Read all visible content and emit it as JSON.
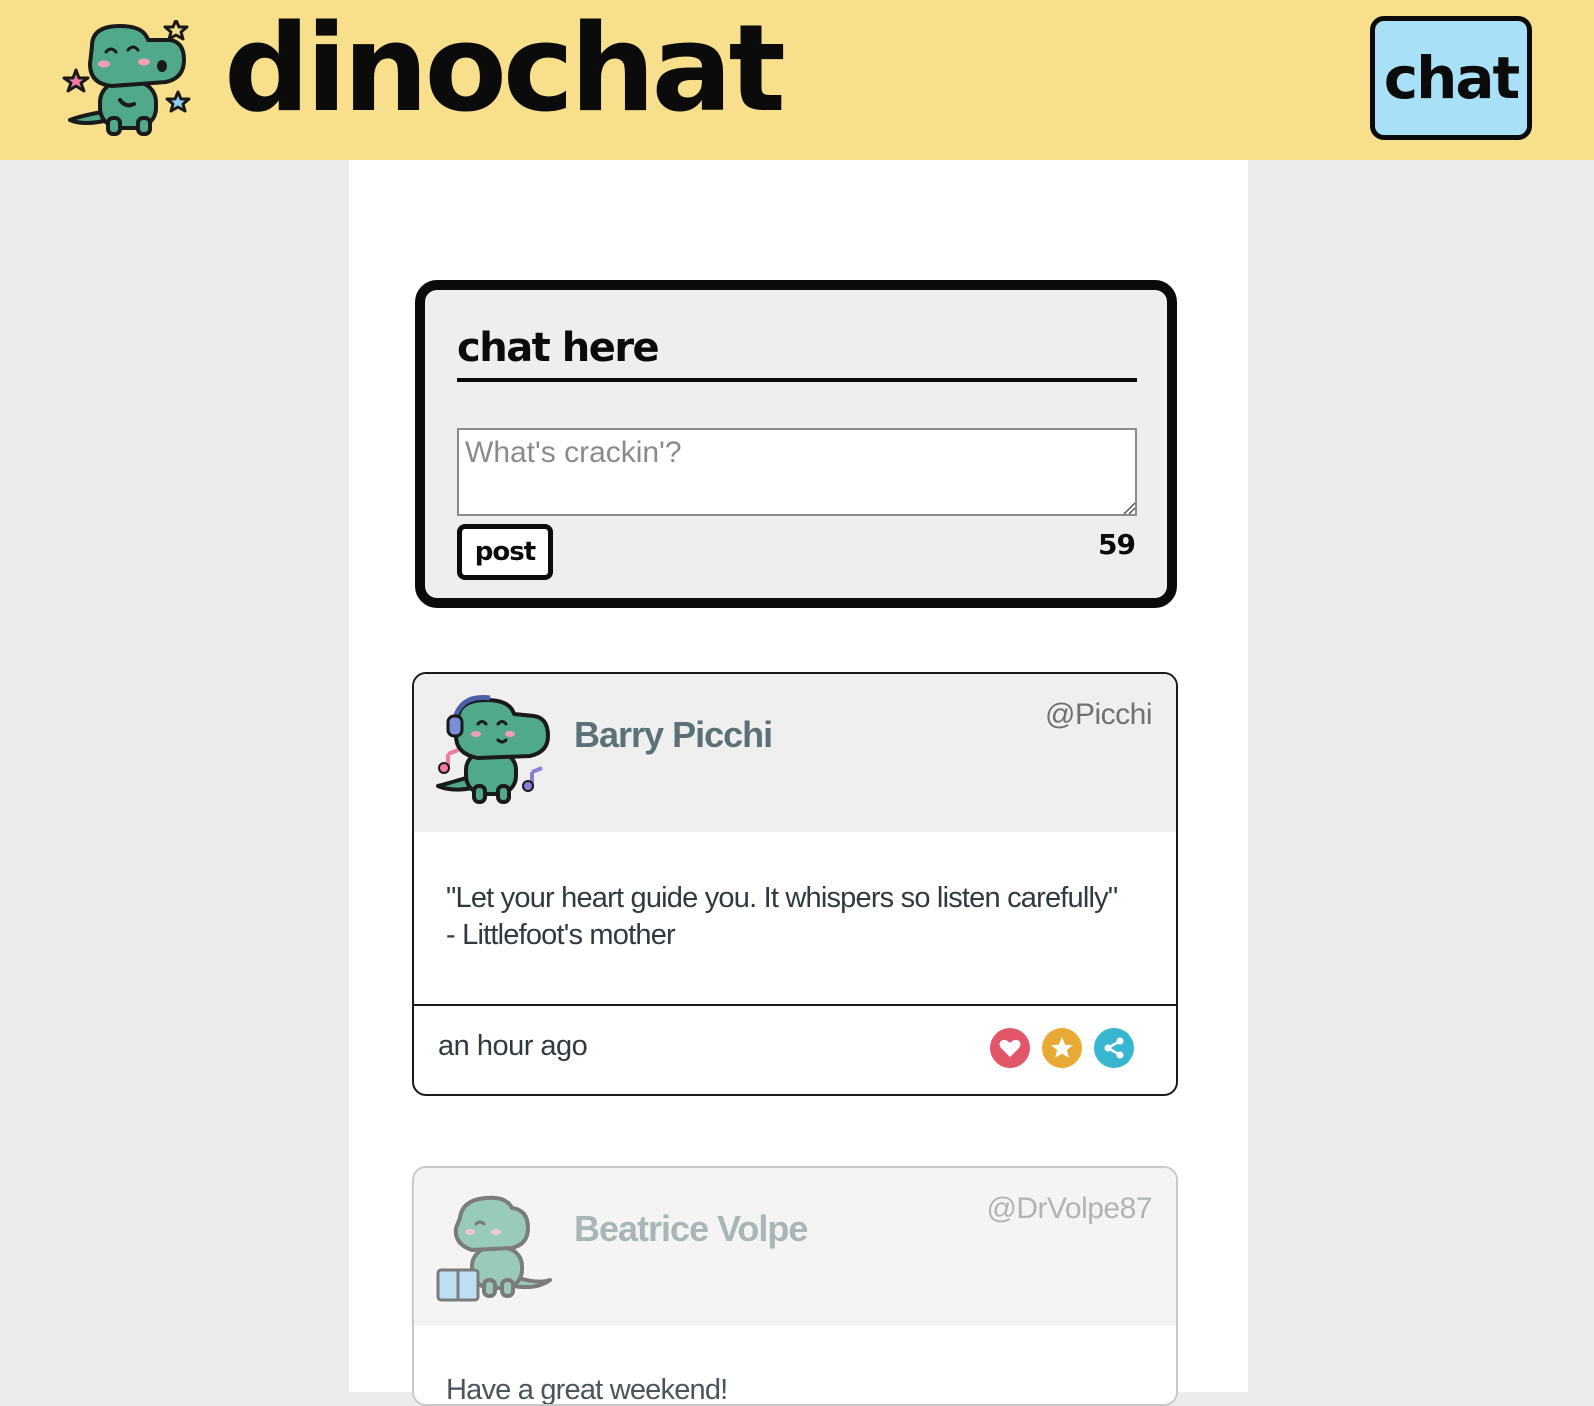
{
  "header": {
    "brand": "dinochat",
    "nav_chat_label": "chat"
  },
  "composer": {
    "title": "chat here",
    "input_placeholder": "What's crackin'?",
    "input_value": "",
    "post_label": "post",
    "char_count": "59"
  },
  "posts": [
    {
      "display_name": "Barry Picchi",
      "handle": "@Picchi",
      "body_line1": "\"Let your heart guide you. It whispers so listen carefully\"",
      "body_line2": "- Littlefoot's mother",
      "timestamp": "an hour ago",
      "avatar_icon": "dino-headphones-icon"
    },
    {
      "display_name": "Beatrice Volpe",
      "handle": "@DrVolpe87",
      "body_line1": "Have a great weekend!",
      "avatar_icon": "dino-reading-icon"
    }
  ],
  "actions": {
    "like_icon": "heart-icon",
    "fav_icon": "star-icon",
    "share_icon": "share-icon"
  },
  "colors": {
    "header_bg": "#f7df8b",
    "nav_button_bg": "#a8e0f7",
    "like": "#e2566a",
    "favorite": "#e9aa35",
    "share": "#37b6cf",
    "dino_green": "#4fa98a"
  }
}
